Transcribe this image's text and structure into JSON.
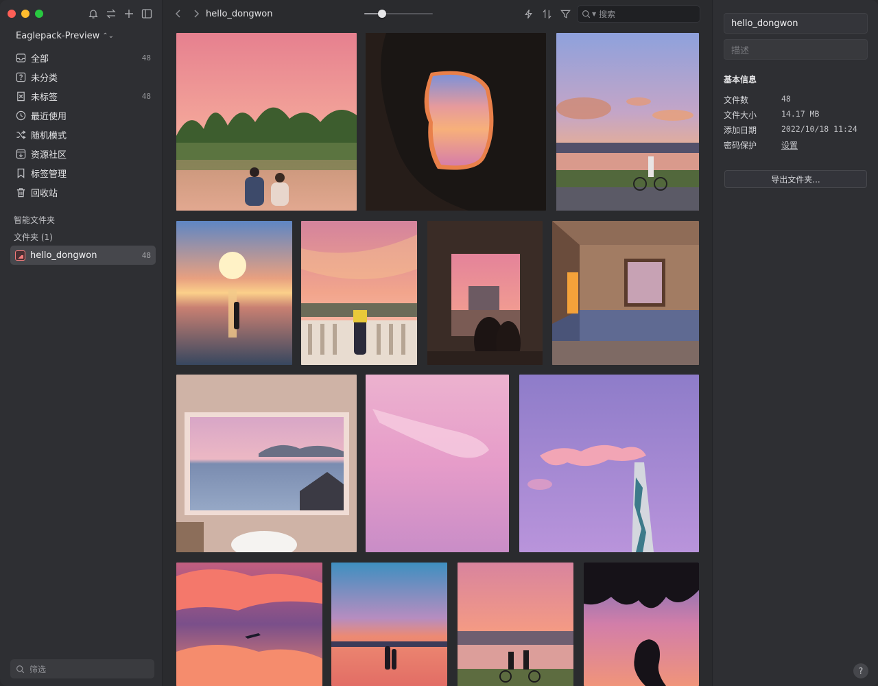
{
  "sidebar": {
    "library_name": "Eaglepack-Preview",
    "items": [
      {
        "icon": "inbox-icon",
        "label": "全部",
        "count": "48"
      },
      {
        "icon": "question-box-icon",
        "label": "未分类",
        "count": ""
      },
      {
        "icon": "untagged-icon",
        "label": "未标签",
        "count": "48"
      },
      {
        "icon": "clock-icon",
        "label": "最近使用",
        "count": ""
      },
      {
        "icon": "shuffle-icon",
        "label": "随机模式",
        "count": ""
      },
      {
        "icon": "download-box-icon",
        "label": "资源社区",
        "count": ""
      },
      {
        "icon": "bookmark-icon",
        "label": "标签管理",
        "count": ""
      },
      {
        "icon": "trash-icon",
        "label": "回收站",
        "count": ""
      }
    ],
    "smart_folders_title": "智能文件夹",
    "folders_title": "文件夹 (1)",
    "folder": {
      "label": "hello_dongwon",
      "count": "48"
    },
    "filter_placeholder": "筛选"
  },
  "toolbar": {
    "breadcrumb": "hello_dongwon",
    "zoom_fraction": 0.26,
    "search_placeholder": "搜索"
  },
  "inspector": {
    "name_value": "hello_dongwon",
    "desc_placeholder": "描述",
    "info_title": "基本信息",
    "rows": [
      {
        "key": "文件数",
        "value": "48"
      },
      {
        "key": "文件大小",
        "value": "14.17 MB"
      },
      {
        "key": "添加日期",
        "value": "2022/10/18 11:24"
      },
      {
        "key": "密码保护",
        "value": "设置"
      }
    ],
    "export_label": "导出文件夹...",
    "help_label": "?"
  }
}
